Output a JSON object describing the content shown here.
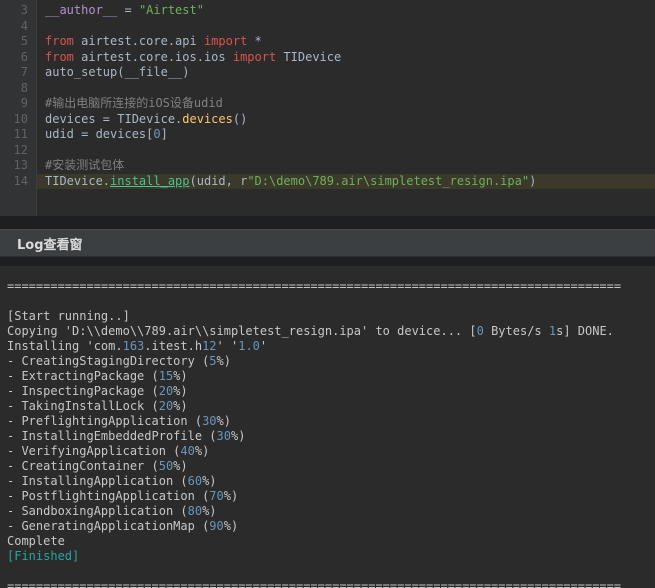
{
  "colors": {
    "editor_background": "#2b2b2b",
    "gutter_background": "#313335",
    "line_number": "#606366",
    "code_default": "#a9b7c6",
    "keyword": "#d9544d",
    "string": "#6faf5c",
    "comment": "#808080",
    "magic_name": "#b094c9",
    "method": "#ffc66d",
    "link_method": "#4dbf90",
    "current_line_highlight": "#3a392a",
    "log_number": "#6897bb",
    "log_finished": "#2aa3a3",
    "header_background": "#3c3f41"
  },
  "editor": {
    "lines": [
      {
        "num": "3",
        "highlight": false,
        "segments": [
          {
            "t": "__author__",
            "c": "magic"
          },
          {
            "t": " = ",
            "c": "default"
          },
          {
            "t": "\"Airtest\"",
            "c": "string"
          }
        ]
      },
      {
        "num": "4",
        "highlight": false,
        "segments": []
      },
      {
        "num": "5",
        "highlight": false,
        "segments": [
          {
            "t": "from ",
            "c": "keyword"
          },
          {
            "t": "airtest.core.api ",
            "c": "default"
          },
          {
            "t": "import ",
            "c": "keyword"
          },
          {
            "t": "*",
            "c": "default"
          }
        ]
      },
      {
        "num": "6",
        "highlight": false,
        "segments": [
          {
            "t": "from ",
            "c": "keyword"
          },
          {
            "t": "airtest.core.ios.ios ",
            "c": "default"
          },
          {
            "t": "import ",
            "c": "keyword"
          },
          {
            "t": "TIDevice",
            "c": "default"
          }
        ]
      },
      {
        "num": "7",
        "highlight": false,
        "segments": [
          {
            "t": "auto_setup(__file__)",
            "c": "default"
          }
        ]
      },
      {
        "num": "8",
        "highlight": false,
        "segments": []
      },
      {
        "num": "9",
        "highlight": false,
        "segments": [
          {
            "t": "#输出电脑所连接的iOS设备udid",
            "c": "comment"
          }
        ]
      },
      {
        "num": "10",
        "highlight": false,
        "segments": [
          {
            "t": "devices = TIDevice.",
            "c": "default"
          },
          {
            "t": "devices",
            "c": "method"
          },
          {
            "t": "()",
            "c": "default"
          }
        ]
      },
      {
        "num": "11",
        "highlight": false,
        "segments": [
          {
            "t": "udid = devices[",
            "c": "default"
          },
          {
            "t": "0",
            "c": "number"
          },
          {
            "t": "]",
            "c": "default"
          }
        ]
      },
      {
        "num": "12",
        "highlight": false,
        "segments": []
      },
      {
        "num": "13",
        "highlight": false,
        "segments": [
          {
            "t": "#安装测试包体",
            "c": "comment"
          }
        ]
      },
      {
        "num": "14",
        "highlight": true,
        "segments": [
          {
            "t": "TIDevice.",
            "c": "default"
          },
          {
            "t": "install_app",
            "c": "link"
          },
          {
            "t": "(udid, r",
            "c": "default"
          },
          {
            "t": "\"D:\\demo\\789.air\\simpletest_resign.ipa\"",
            "c": "string"
          },
          {
            "t": ")",
            "c": "default"
          }
        ]
      }
    ]
  },
  "log_panel": {
    "header": "Log查看窗",
    "lines": [
      {
        "segments": [
          {
            "t": "=====================================================================================",
            "c": "default"
          }
        ]
      },
      {
        "segments": []
      },
      {
        "segments": [
          {
            "t": "[Start running..]",
            "c": "default"
          }
        ]
      },
      {
        "segments": [
          {
            "t": "Copying 'D:\\\\demo\\\\789.air\\\\simpletest_resign.ipa' to device... [",
            "c": "default"
          },
          {
            "t": "0",
            "c": "number"
          },
          {
            "t": " Bytes/s ",
            "c": "default"
          },
          {
            "t": "1",
            "c": "number"
          },
          {
            "t": "s] DONE.",
            "c": "default"
          }
        ]
      },
      {
        "segments": [
          {
            "t": "Installing 'com.",
            "c": "default"
          },
          {
            "t": "163",
            "c": "number"
          },
          {
            "t": ".itest.h",
            "c": "default"
          },
          {
            "t": "12",
            "c": "number"
          },
          {
            "t": "' '",
            "c": "default"
          },
          {
            "t": "1.0",
            "c": "number"
          },
          {
            "t": "'",
            "c": "default"
          }
        ]
      },
      {
        "segments": [
          {
            "t": "- CreatingStagingDirectory (",
            "c": "default"
          },
          {
            "t": "5",
            "c": "number"
          },
          {
            "t": "%)",
            "c": "default"
          }
        ]
      },
      {
        "segments": [
          {
            "t": "- ExtractingPackage (",
            "c": "default"
          },
          {
            "t": "15",
            "c": "number"
          },
          {
            "t": "%)",
            "c": "default"
          }
        ]
      },
      {
        "segments": [
          {
            "t": "- InspectingPackage (",
            "c": "default"
          },
          {
            "t": "20",
            "c": "number"
          },
          {
            "t": "%)",
            "c": "default"
          }
        ]
      },
      {
        "segments": [
          {
            "t": "- TakingInstallLock (",
            "c": "default"
          },
          {
            "t": "20",
            "c": "number"
          },
          {
            "t": "%)",
            "c": "default"
          }
        ]
      },
      {
        "segments": [
          {
            "t": "- PreflightingApplication (",
            "c": "default"
          },
          {
            "t": "30",
            "c": "number"
          },
          {
            "t": "%)",
            "c": "default"
          }
        ]
      },
      {
        "segments": [
          {
            "t": "- InstallingEmbeddedProfile (",
            "c": "default"
          },
          {
            "t": "30",
            "c": "number"
          },
          {
            "t": "%)",
            "c": "default"
          }
        ]
      },
      {
        "segments": [
          {
            "t": "- VerifyingApplication (",
            "c": "default"
          },
          {
            "t": "40",
            "c": "number"
          },
          {
            "t": "%)",
            "c": "default"
          }
        ]
      },
      {
        "segments": [
          {
            "t": "- CreatingContainer (",
            "c": "default"
          },
          {
            "t": "50",
            "c": "number"
          },
          {
            "t": "%)",
            "c": "default"
          }
        ]
      },
      {
        "segments": [
          {
            "t": "- InstallingApplication (",
            "c": "default"
          },
          {
            "t": "60",
            "c": "number"
          },
          {
            "t": "%)",
            "c": "default"
          }
        ]
      },
      {
        "segments": [
          {
            "t": "- PostflightingApplication (",
            "c": "default"
          },
          {
            "t": "70",
            "c": "number"
          },
          {
            "t": "%)",
            "c": "default"
          }
        ]
      },
      {
        "segments": [
          {
            "t": "- SandboxingApplication (",
            "c": "default"
          },
          {
            "t": "80",
            "c": "number"
          },
          {
            "t": "%)",
            "c": "default"
          }
        ]
      },
      {
        "segments": [
          {
            "t": "- GeneratingApplicationMap (",
            "c": "default"
          },
          {
            "t": "90",
            "c": "number"
          },
          {
            "t": "%)",
            "c": "default"
          }
        ]
      },
      {
        "segments": [
          {
            "t": "Complete",
            "c": "default"
          }
        ]
      },
      {
        "segments": [
          {
            "t": "[Finished]",
            "c": "finished"
          }
        ]
      },
      {
        "segments": []
      },
      {
        "segments": [
          {
            "t": "=====================================================================================",
            "c": "default"
          }
        ]
      }
    ]
  }
}
